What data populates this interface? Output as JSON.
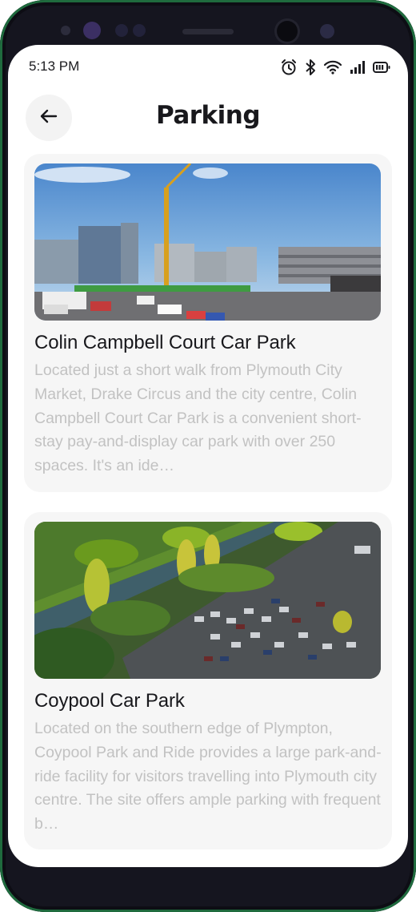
{
  "status_bar": {
    "time": "5:13 PM",
    "icons": [
      "alarm-icon",
      "bluetooth-icon",
      "wifi-icon",
      "signal-icon",
      "battery-icon"
    ]
  },
  "header": {
    "back_icon": "arrow-left-icon",
    "title": "Parking"
  },
  "car_parks": [
    {
      "name": "Colin Campbell Court Car Park",
      "description": "Located just a short walk from Plymouth City Market, Drake Circus and the city centre, Colin Campbell Court Car Park is a convenient short-stay pay-and-display car park with over 250 spaces. It's an ide…"
    },
    {
      "name": "Coypool Car Park",
      "description": "Located on the southern edge of Plympton, Coypool Park and Ride provides a large park-and-ride facility for visitors travelling into Plymouth city centre. The site offers ample parking with frequent b…"
    }
  ],
  "colors": {
    "title_text": "#18181c",
    "description_text": "#c2c2c2",
    "card_background": "#f6f6f6",
    "back_button_background": "#f3f3f3"
  }
}
